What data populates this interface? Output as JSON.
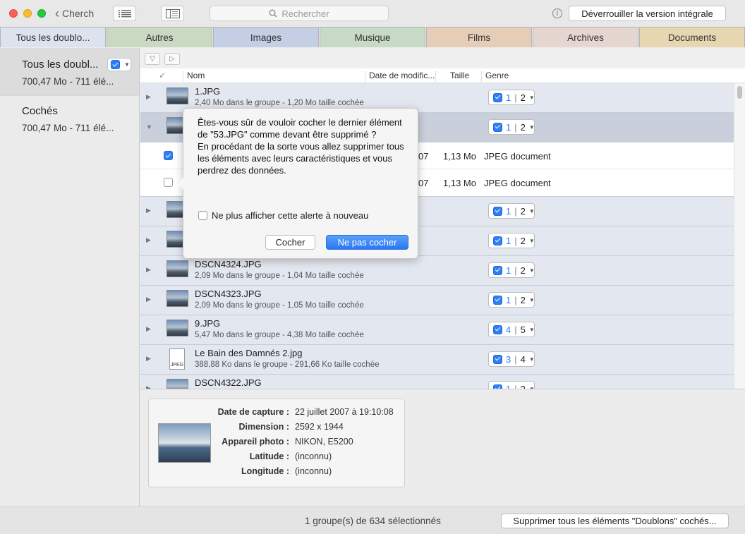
{
  "titlebar": {
    "back_label": "Cherch",
    "search_placeholder": "Rechercher",
    "unlock_label": "Déverrouiller la version intégrale"
  },
  "tabs": [
    {
      "label": "Tous les doublo...",
      "color": "#dde2ef",
      "active": true
    },
    {
      "label": "Autres",
      "color": "#c9d9c2"
    },
    {
      "label": "Images",
      "color": "#c4cfe6"
    },
    {
      "label": "Musique",
      "color": "#c6dac6"
    },
    {
      "label": "Films",
      "color": "#e6cdb7"
    },
    {
      "label": "Archives",
      "color": "#e6d6d0"
    },
    {
      "label": "Documents",
      "color": "#e6d7b0"
    }
  ],
  "sidebar": {
    "items": [
      {
        "title": "Tous les doubl...",
        "sub": "700,47 Mo - 711 élé..."
      },
      {
        "title": "Cochés",
        "sub": "700,47 Mo - 711 élé..."
      }
    ]
  },
  "columns": {
    "check": "✓",
    "name": "Nom",
    "date": "Date de modific...",
    "size": "Taille",
    "kind": "Genre"
  },
  "rows": {
    "r0": {
      "name": "1.JPG",
      "meta": "2,40 Mo dans le groupe - 1,20 Mo taille cochée",
      "checked": "1",
      "total": "2"
    },
    "r1": {
      "checked": "1",
      "total": "2"
    },
    "c1": {
      "date": "07",
      "size": "1,13 Mo",
      "kind": "JPEG document"
    },
    "c2": {
      "date": "07",
      "size": "1,13 Mo",
      "kind": "JPEG document"
    },
    "r2": {
      "checked": "1",
      "total": "2"
    },
    "r3": {
      "checked": "1",
      "total": "2"
    },
    "r4": {
      "name": "DSCN4324.JPG",
      "meta": "2,09 Mo dans le groupe - 1,04 Mo taille cochée",
      "checked": "1",
      "total": "2"
    },
    "r5": {
      "name": "DSCN4323.JPG",
      "meta": "2,09 Mo dans le groupe - 1,05 Mo taille cochée",
      "checked": "1",
      "total": "2"
    },
    "r6": {
      "name": "9.JPG",
      "meta": "5,47 Mo dans le groupe - 4,38 Mo taille cochée",
      "checked": "4",
      "total": "5"
    },
    "r7": {
      "name": "Le Bain des Damnés 2.jpg",
      "meta": "388,88 Ko dans le groupe - 291,66 Ko taille cochée",
      "checked": "3",
      "total": "4",
      "icon_label": "JPEG"
    },
    "r8": {
      "name": "DSCN4322.JPG",
      "checked": "1",
      "total": "2"
    }
  },
  "popover": {
    "line1": "Êtes-vous sûr de vouloir cocher le dernier élément de \"53.JPG\" comme devant être supprimé ?",
    "line2": "En procédant de la sorte vous allez supprimer tous les éléments avec leurs caractéristiques et vous perdrez des données.",
    "dont_show": "Ne plus afficher cette alerte à nouveau",
    "confirm": "Cocher",
    "cancel": "Ne pas cocher"
  },
  "details": [
    {
      "label": "Date de capture :",
      "value": "22 juillet 2007 à 19:10:08"
    },
    {
      "label": "Dimension :",
      "value": "2592 x 1944"
    },
    {
      "label": "Appareil photo :",
      "value": "NIKON, E5200"
    },
    {
      "label": "Latitude :",
      "value": "(inconnu)"
    },
    {
      "label": "Longitude :",
      "value": "(inconnu)"
    }
  ],
  "status": {
    "text": "1 groupe(s) de 634 sélectionnés",
    "delete_label": "Supprimer tous les éléments \"Doublons\" cochés..."
  }
}
